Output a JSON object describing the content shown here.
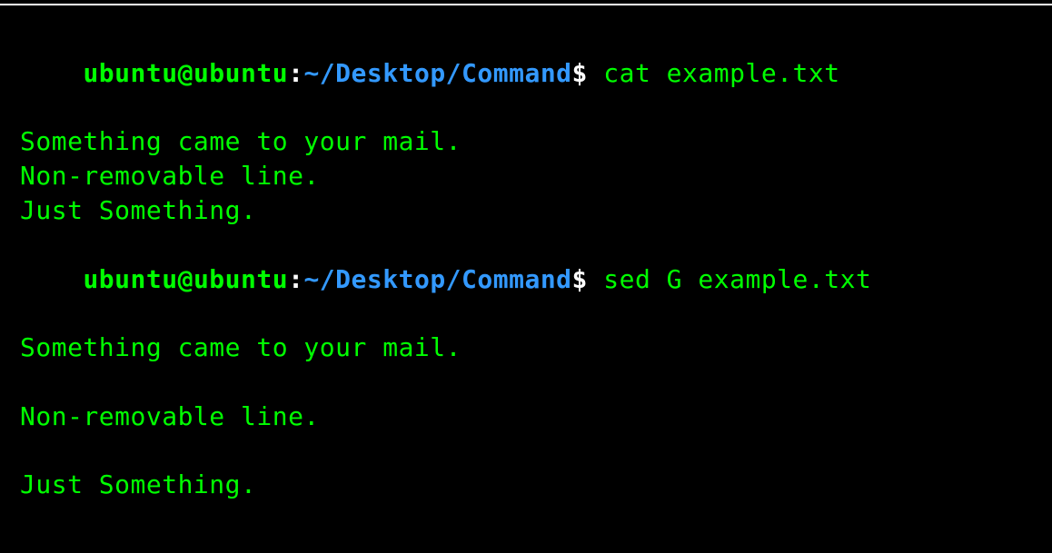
{
  "prompt": {
    "user": "ubuntu@ubuntu",
    "colon": ":",
    "path": "~/Desktop/Command",
    "dollar": "$"
  },
  "commands": [
    {
      "cmd": " cat example.txt",
      "output": [
        "Something came to your mail.",
        "Non-removable line.",
        "Just Something."
      ]
    },
    {
      "cmd": " sed G example.txt",
      "output": [
        "Something came to your mail.",
        "",
        "Non-removable line.",
        "",
        "Just Something.",
        ""
      ]
    }
  ]
}
